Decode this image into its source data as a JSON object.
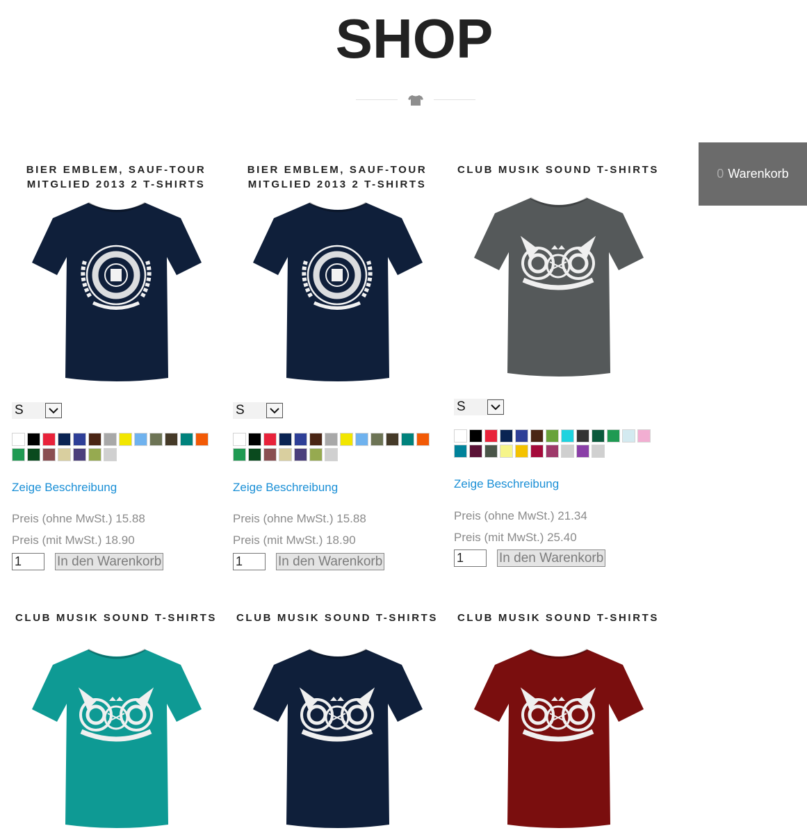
{
  "page": {
    "title": "SHOP"
  },
  "cart": {
    "count": "0",
    "label": "Warenkorb"
  },
  "products": [
    {
      "title_line1": "BIER EMBLEM, SAUF-TOUR",
      "title_line2": "MITGLIED 2013 2 T-SHIRTS",
      "shirt_color": "#0f1f3a",
      "print_type": "emblem",
      "size": "S",
      "colors": [
        "#ffffff",
        "#000000",
        "#e8223a",
        "#0a2453",
        "#2e3f97",
        "#4a2514",
        "#a8a8a8",
        "#f2e600",
        "#6fb2ee",
        "#6d7455",
        "#453a28",
        "#00827c",
        "#f25a06",
        "#1f9a52",
        "#0a4a1e",
        "#8a4f52",
        "#d9cf9f",
        "#4b3f7c",
        "#96aa50",
        "#d0d0d0"
      ],
      "desc_link": "Zeige Beschreibung",
      "price_net": "Preis (ohne MwSt.) 15.88",
      "price_gross": "Preis (mit MwSt.) 18.90",
      "qty": "1",
      "add_label": "In den Warenkorb"
    },
    {
      "title_line1": "BIER EMBLEM, SAUF-TOUR",
      "title_line2": "MITGLIED 2013 2 T-SHIRTS",
      "shirt_color": "#0f1f3a",
      "print_type": "emblem",
      "size": "S",
      "colors": [
        "#ffffff",
        "#000000",
        "#e8223a",
        "#0a2453",
        "#2e3f97",
        "#4a2514",
        "#a8a8a8",
        "#f2e600",
        "#6fb2ee",
        "#6d7455",
        "#453a28",
        "#00827c",
        "#f25a06",
        "#1f9a52",
        "#0a4a1e",
        "#8a4f52",
        "#d9cf9f",
        "#4b3f7c",
        "#96aa50",
        "#d0d0d0"
      ],
      "desc_link": "Zeige Beschreibung",
      "price_net": "Preis (ohne MwSt.) 15.88",
      "price_gross": "Preis (mit MwSt.) 18.90",
      "qty": "1",
      "add_label": "In den Warenkorb"
    },
    {
      "title_line1": "CLUB MUSIK SOUND T-SHIRTS",
      "title_line2": "",
      "shirt_color": "#55595a",
      "print_type": "speakers",
      "size": "S",
      "colors": [
        "#ffffff",
        "#000000",
        "#e8223a",
        "#0a2453",
        "#2e3f97",
        "#4a2514",
        "#69a23a",
        "#1ed3df",
        "#333333",
        "#0b5a3c",
        "#1f9a52",
        "#d3eaf0",
        "#f2aed2",
        "#00829a",
        "#5a1236",
        "#4a5548",
        "#f6f58a",
        "#f4c200",
        "#a40a3a",
        "#9e3a6a",
        "#cfcfcf",
        "#8a3fa7",
        "#d0d0d0"
      ],
      "desc_link": "Zeige Beschreibung",
      "price_net": "Preis (ohne MwSt.) 21.34",
      "price_gross": "Preis (mit MwSt.) 25.40",
      "qty": "1",
      "add_label": "In den Warenkorb"
    },
    {
      "title_line1": "CLUB MUSIK SOUND T-SHIRTS",
      "title_line2": "",
      "shirt_color": "#0e9a94",
      "print_type": "speakers"
    },
    {
      "title_line1": "CLUB MUSIK SOUND T-SHIRTS",
      "title_line2": "",
      "shirt_color": "#0f1f3a",
      "print_type": "speakers"
    },
    {
      "title_line1": "CLUB MUSIK SOUND T-SHIRTS",
      "title_line2": "",
      "shirt_color": "#7a0e0e",
      "print_type": "speakers"
    }
  ]
}
